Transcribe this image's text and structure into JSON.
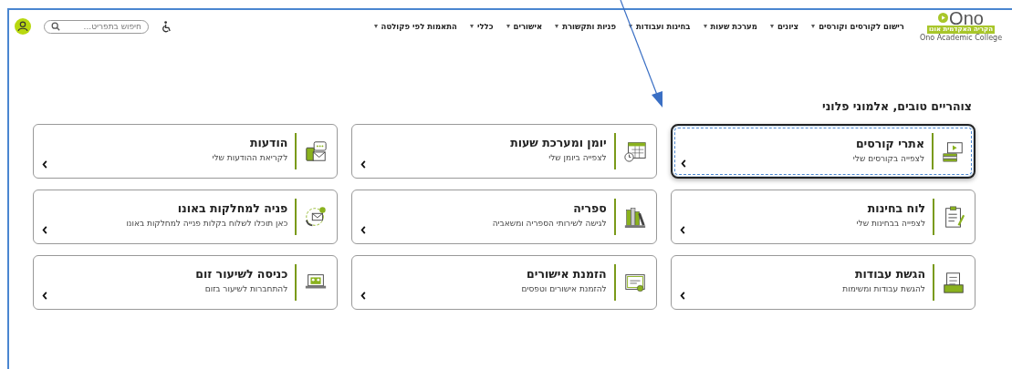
{
  "logo": {
    "wordmark": "Ono",
    "hebrew_name": "הקריה האקדמית אונו",
    "english_name": "Ono Academic College"
  },
  "nav": [
    {
      "label": "רישום לקורסים וקורסים"
    },
    {
      "label": "ציונים"
    },
    {
      "label": "מערכת שעות"
    },
    {
      "label": "בחינות ועבודות"
    },
    {
      "label": "פניות ותקשורת"
    },
    {
      "label": "אישורים"
    },
    {
      "label": "כללי"
    },
    {
      "label": "התאמות לפי פקולטה"
    }
  ],
  "search": {
    "placeholder": "חיפוש בתפריט..."
  },
  "greeting": "צוהריים טובים, אלמוני פלוני",
  "cards": [
    {
      "title": "אתרי קורסים",
      "subtitle": "לצפייה בקורסים שלי",
      "selected": true
    },
    {
      "title": "יומן ומערכת שעות",
      "subtitle": "לצפייה ביומן שלי",
      "selected": false
    },
    {
      "title": "הודעות",
      "subtitle": "לקריאת ההודעות שלי",
      "selected": false
    },
    {
      "title": "לוח בחינות",
      "subtitle": "לצפייה בבחינות שלי",
      "selected": false
    },
    {
      "title": "ספריה",
      "subtitle": "לגישה לשירותי הספריה ומשאביה",
      "selected": false
    },
    {
      "title": "פניה למחלקות באונו",
      "subtitle": "כאן תוכלו לשלוח בקלות פנייה למחלקות באונו",
      "selected": false
    },
    {
      "title": "הגשת עבודות",
      "subtitle": "להגשת עבודות ומשימות",
      "selected": false
    },
    {
      "title": "הזמנת אישורים",
      "subtitle": "להזמנת אישורים וטפסים",
      "selected": false
    },
    {
      "title": "כניסה לשיעור זום",
      "subtitle": "להתחברות לשיעור בזום",
      "selected": false
    }
  ]
}
